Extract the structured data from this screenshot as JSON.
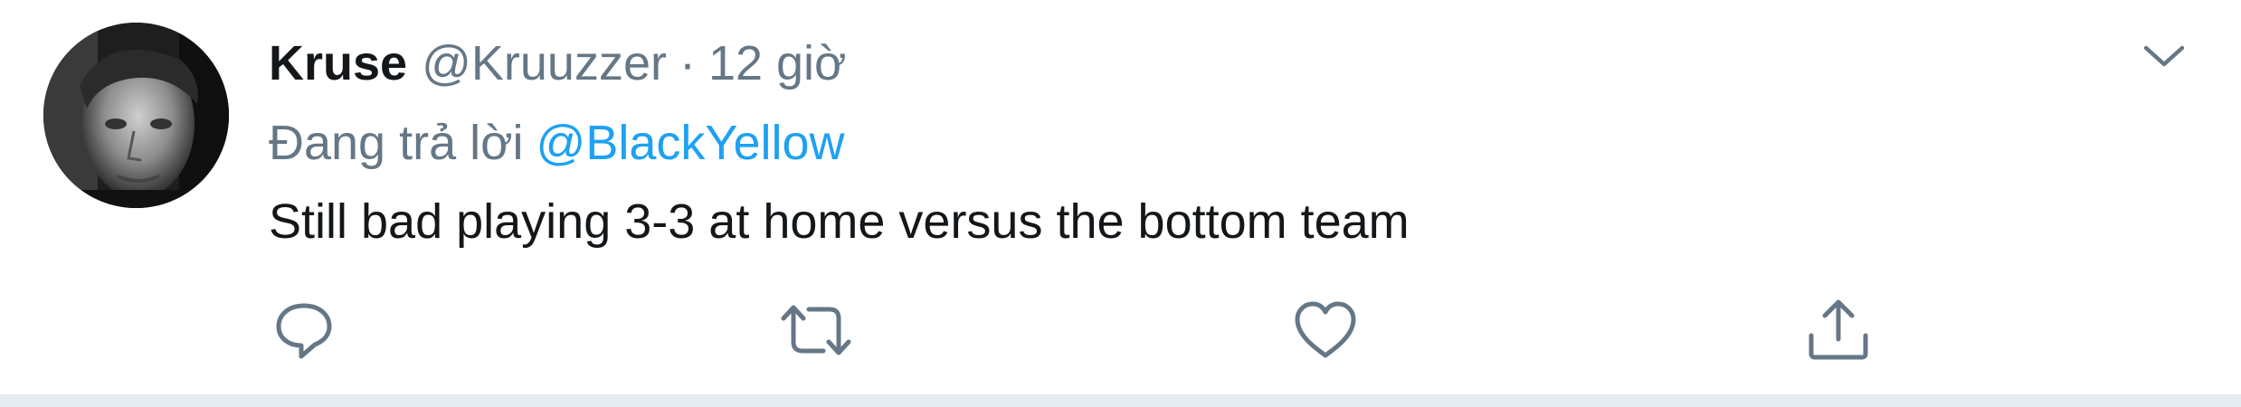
{
  "tweet": {
    "author_name": "Kruse",
    "author_handle": "@Kruuzzer",
    "separator": "·",
    "timestamp": "12 giờ",
    "reply_prefix": "Đang trả lời",
    "reply_to_handle": "@BlackYellow",
    "text": "Still bad playing 3-3 at home versus the bottom team"
  },
  "icons": {
    "more": "chevron-down-icon",
    "reply": "reply-bubble-icon",
    "retweet": "retweet-icon",
    "like": "heart-icon",
    "share": "share-icon"
  },
  "colors": {
    "text_primary": "#14171a",
    "text_secondary": "#657786",
    "link": "#1da1f2",
    "icon": "#657786",
    "border": "#e6ecf0"
  }
}
